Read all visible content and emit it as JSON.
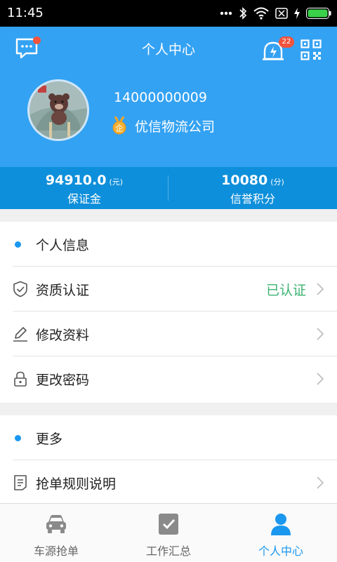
{
  "status_bar": {
    "time": "11:45",
    "icons": [
      "more-dots-icon",
      "bluetooth-icon",
      "wifi-icon",
      "sim-blocked-icon",
      "charging-icon",
      "battery-icon"
    ]
  },
  "header": {
    "title": "个人中心",
    "message_icon": "chat-message-icon",
    "alarm_icon": "alarm-light-icon",
    "alarm_badge": "22",
    "qr_icon": "qr-code-icon",
    "background_color": "#34a2f3"
  },
  "profile": {
    "phone": "14000000009",
    "company_badge": "企",
    "company": "优信物流公司"
  },
  "stats": {
    "deposit": {
      "value": "94910.0",
      "unit": "(元)",
      "label": "保证金"
    },
    "credit": {
      "value": "10080",
      "unit": "(分)",
      "label": "信誉积分"
    }
  },
  "section_personal": {
    "header": "个人信息",
    "items": [
      {
        "label": "资质认证",
        "icon": "shield-check-icon",
        "status": "已认证"
      },
      {
        "label": "修改资料",
        "icon": "edit-pen-icon"
      },
      {
        "label": "更改密码",
        "icon": "lock-icon"
      }
    ]
  },
  "section_more": {
    "header": "更多",
    "items": [
      {
        "label": "抢单规则说明",
        "icon": "document-icon"
      }
    ]
  },
  "tabbar": {
    "tabs": [
      {
        "label": "车源抢单",
        "icon": "car-icon"
      },
      {
        "label": "工作汇总",
        "icon": "checklist-icon"
      },
      {
        "label": "个人中心",
        "icon": "user-icon"
      }
    ],
    "active_index": 2,
    "active_color": "#1a97ee"
  }
}
